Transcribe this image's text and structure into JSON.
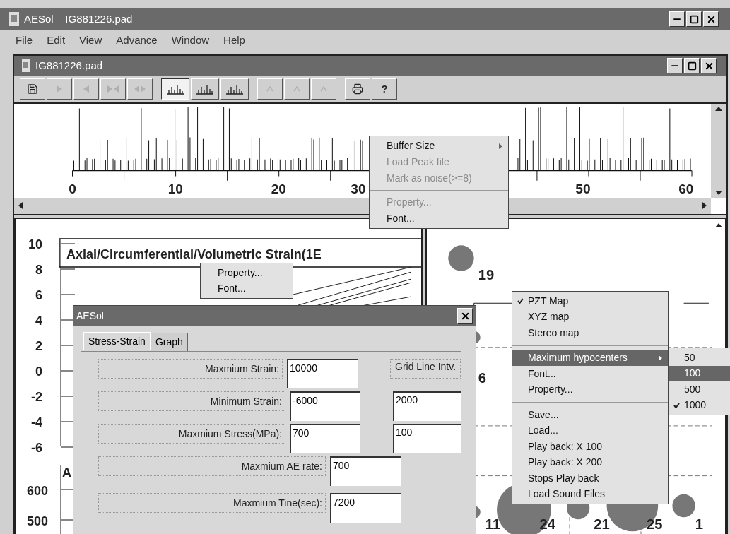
{
  "window": {
    "title": "AESol – IG881226.pad"
  },
  "menu_bar": [
    {
      "label": "File"
    },
    {
      "label": "Edit"
    },
    {
      "label": "View"
    },
    {
      "label": "Advance"
    },
    {
      "label": "Window"
    },
    {
      "label": "Help"
    }
  ],
  "document": {
    "title": "IG881226.pad"
  },
  "toolbar": [
    {
      "kind": "save",
      "disabled": false,
      "pressed": false
    },
    {
      "kind": "play",
      "disabled": true,
      "pressed": false
    },
    {
      "kind": "reverse",
      "disabled": true,
      "pressed": false
    },
    {
      "kind": "ends",
      "disabled": true,
      "pressed": false
    },
    {
      "kind": "step",
      "disabled": true,
      "pressed": false
    },
    {
      "kind": "view",
      "disabled": false,
      "pressed": true
    },
    {
      "kind": "view",
      "disabled": false,
      "pressed": false
    },
    {
      "kind": "view",
      "disabled": false,
      "pressed": false
    },
    {
      "kind": "blank",
      "disabled": true,
      "pressed": false
    },
    {
      "kind": "blank",
      "disabled": true,
      "pressed": false
    },
    {
      "kind": "blank",
      "disabled": true,
      "pressed": false
    },
    {
      "kind": "print",
      "disabled": false,
      "pressed": false
    },
    {
      "kind": "help",
      "disabled": false,
      "pressed": false,
      "label": "?"
    }
  ],
  "peak_chart": {
    "axis_labels": [
      "0",
      "10",
      "20",
      "30",
      "50",
      "60"
    ]
  },
  "peak_menu": [
    {
      "kind": "item",
      "label": "Buffer Size",
      "disabled": false,
      "submenu": true
    },
    {
      "kind": "item",
      "label": "Load Peak file",
      "disabled": true,
      "submenu": false
    },
    {
      "kind": "item",
      "label": "Mark as noise(>=8)",
      "disabled": true,
      "submenu": false
    },
    {
      "kind": "separator"
    },
    {
      "kind": "item",
      "label": "Property...",
      "disabled": true,
      "submenu": false
    },
    {
      "kind": "item",
      "label": "Font...",
      "disabled": false,
      "submenu": false
    }
  ],
  "strain_chart": {
    "title": "Axial/Circumferential/Volumetric Strain(1E",
    "y_labels": [
      "10",
      "8",
      "6",
      "4",
      "2",
      "0",
      "-2",
      "-4",
      "-6"
    ]
  },
  "strain_menu": [
    {
      "label": "Property..."
    },
    {
      "label": "Font..."
    }
  ],
  "rate_chart": {
    "title": "A",
    "y_labels": [
      "600",
      "500"
    ]
  },
  "map": {
    "labels": [
      "19",
      "6",
      "11",
      "24",
      "21",
      "25",
      "1"
    ]
  },
  "map_menu": [
    {
      "kind": "item",
      "label": "PZT Map",
      "checked": true,
      "selected": false,
      "submenu": false
    },
    {
      "kind": "item",
      "label": "XYZ map",
      "checked": false,
      "selected": false,
      "submenu": false
    },
    {
      "kind": "item",
      "label": "Stereo map",
      "checked": false,
      "selected": false,
      "submenu": false
    },
    {
      "kind": "separator"
    },
    {
      "kind": "item",
      "label": "Maximum hypocenters",
      "checked": false,
      "selected": true,
      "submenu": true
    },
    {
      "kind": "item",
      "label": "Font...",
      "checked": false,
      "selected": false,
      "submenu": false
    },
    {
      "kind": "item",
      "label": "Property...",
      "checked": false,
      "selected": false,
      "submenu": false
    },
    {
      "kind": "separator"
    },
    {
      "kind": "item",
      "label": "Save...",
      "checked": false,
      "selected": false,
      "submenu": false
    },
    {
      "kind": "item",
      "label": "Load...",
      "checked": false,
      "selected": false,
      "submenu": false
    },
    {
      "kind": "item",
      "label": "Play back: X 100",
      "checked": false,
      "selected": false,
      "submenu": false
    },
    {
      "kind": "item",
      "label": "Play back: X 200",
      "checked": false,
      "selected": false,
      "submenu": false
    },
    {
      "kind": "item",
      "label": "Stops Play back",
      "checked": false,
      "selected": false,
      "submenu": false
    },
    {
      "kind": "item",
      "label": "Load Sound Files",
      "checked": false,
      "selected": false,
      "submenu": false
    }
  ],
  "hypocenter_submenu": [
    {
      "label": "50",
      "checked": false,
      "selected": false
    },
    {
      "label": "100",
      "checked": false,
      "selected": true
    },
    {
      "label": "500",
      "checked": false,
      "selected": false
    },
    {
      "label": "1000",
      "checked": true,
      "selected": false
    }
  ],
  "dialog": {
    "title": "AESol",
    "tabs": [
      {
        "label": "Stress-Strain",
        "selected": true
      },
      {
        "label": "Graph",
        "selected": false
      }
    ],
    "rows": [
      {
        "label": "Maxmium Strain:",
        "value": "10000",
        "side_label": "Grid Line Intv."
      },
      {
        "label": "Minimum Strain:",
        "value": "-6000",
        "side_value": "2000"
      },
      {
        "label": "Maxmium Stress(MPa):",
        "value": "700",
        "side_value": "100"
      },
      {
        "label": "Maxmium AE rate:",
        "value": "700"
      },
      {
        "label": "Maxmium Tine(sec):",
        "value": "7200"
      }
    ]
  }
}
